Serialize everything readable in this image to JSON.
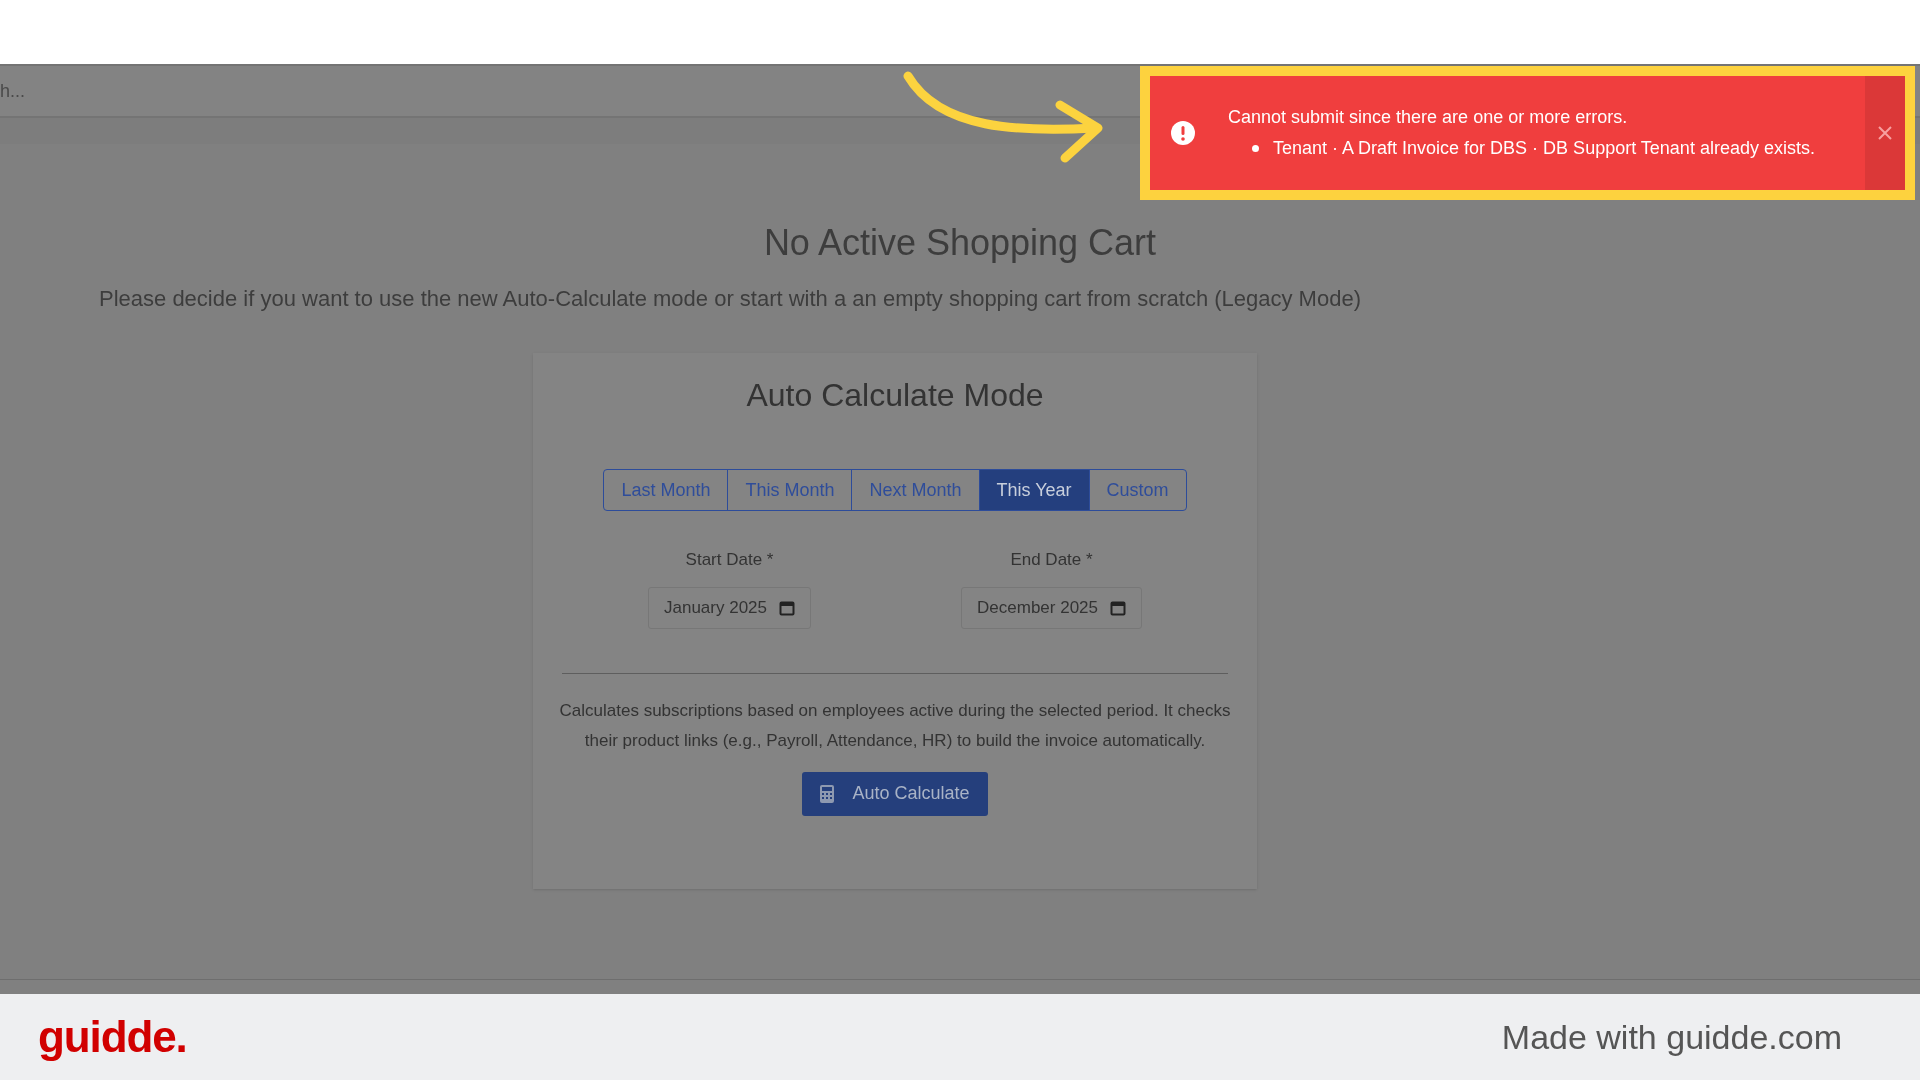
{
  "search": {
    "value": "h..."
  },
  "page": {
    "title": "No Active Shopping Cart",
    "subtitle": "Please decide if you want to use the new Auto-Calculate mode or start with a an empty shopping cart from scratch (Legacy Mode)"
  },
  "card": {
    "title": "Auto Calculate Mode",
    "tabs": [
      {
        "label": "Last Month",
        "selected": false
      },
      {
        "label": "This Month",
        "selected": false
      },
      {
        "label": "Next Month",
        "selected": false
      },
      {
        "label": "This Year",
        "selected": true
      },
      {
        "label": "Custom",
        "selected": false
      }
    ],
    "fields": [
      {
        "label": "Start Date *",
        "value": "January 2025"
      },
      {
        "label": "End Date *",
        "value": "December 2025"
      }
    ],
    "description": "Calculates subscriptions based on employees active during the selected period. It checks their product links (e.g., Payroll, Attendance, HR) to build the invoice automatically.",
    "button": "Auto Calculate"
  },
  "toast": {
    "title": "Cannot submit since there are one or more errors.",
    "errors": [
      "Tenant · A Draft Invoice for DBS · DB Support Tenant already exists."
    ]
  },
  "footer": {
    "logo": "guidde.",
    "credit": "Made with guidde.com"
  }
}
